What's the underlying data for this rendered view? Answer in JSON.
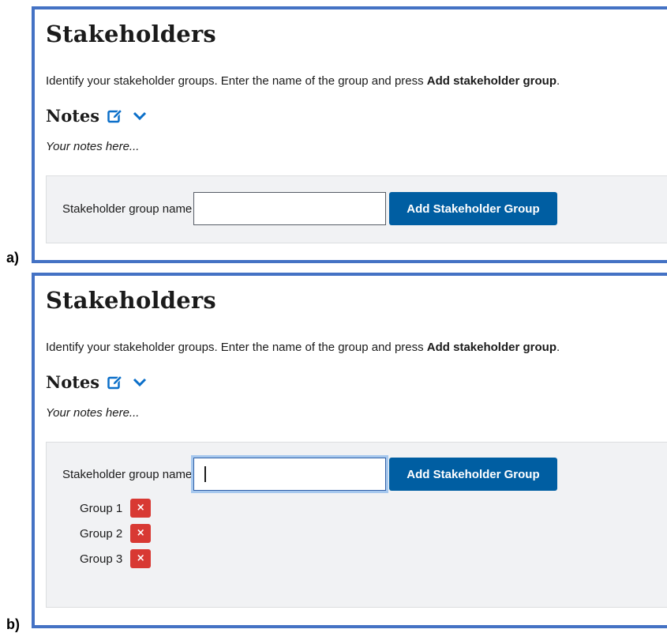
{
  "panels": [
    {
      "letter": "a)",
      "title": "Stakeholders",
      "intro_prefix": "Identify your stakeholder groups. Enter the name of the group and press ",
      "intro_bold": "Add stakeholder group",
      "intro_suffix": ".",
      "notes_heading": "Notes",
      "notes_text": "Your notes here...",
      "field_label": "Stakeholder group name",
      "input_value": "",
      "add_button_label": "Add Stakeholder Group",
      "groups": []
    },
    {
      "letter": "b)",
      "title": "Stakeholders",
      "intro_prefix": "Identify your stakeholder groups. Enter the name of the group and press ",
      "intro_bold": "Add stakeholder group",
      "intro_suffix": ".",
      "notes_heading": "Notes",
      "notes_text": "Your notes here...",
      "field_label": "Stakeholder group name",
      "input_value": "",
      "add_button_label": "Add Stakeholder Group",
      "remove_icon_glyph": "×",
      "groups": [
        {
          "label": "Group 1"
        },
        {
          "label": "Group 2"
        },
        {
          "label": "Group 3"
        }
      ]
    }
  ],
  "colors": {
    "panel_border": "#4472c4",
    "primary_button": "#005ea2",
    "remove_button": "#d83933",
    "icon_blue": "#0b6fc9",
    "form_background": "#f1f2f4"
  },
  "icons": {
    "edit": "edit-icon",
    "expand": "chevron-down-icon",
    "remove": "close-icon"
  }
}
